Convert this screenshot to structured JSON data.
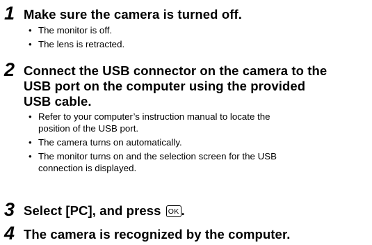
{
  "steps": [
    {
      "number": "1",
      "title": "Make sure the camera is turned off.",
      "bullets": [
        "The monitor is off.",
        "The lens is retracted."
      ]
    },
    {
      "number": "2",
      "title_lines": [
        "Connect the USB connector on the camera to the",
        "USB port on the computer using the provided",
        "USB cable."
      ],
      "bullets": [
        [
          "Refer to your computer’s instruction manual to locate the",
          "position of the USB port."
        ],
        [
          "The camera turns on automatically."
        ],
        [
          "The monitor turns on and the selection screen for the USB",
          "connection is displayed."
        ]
      ]
    },
    {
      "number": "3",
      "title": "Select [PC], and press",
      "button_label": "OK",
      "title_end": "."
    },
    {
      "number": "4",
      "title": "The camera is recognized by the computer."
    }
  ]
}
